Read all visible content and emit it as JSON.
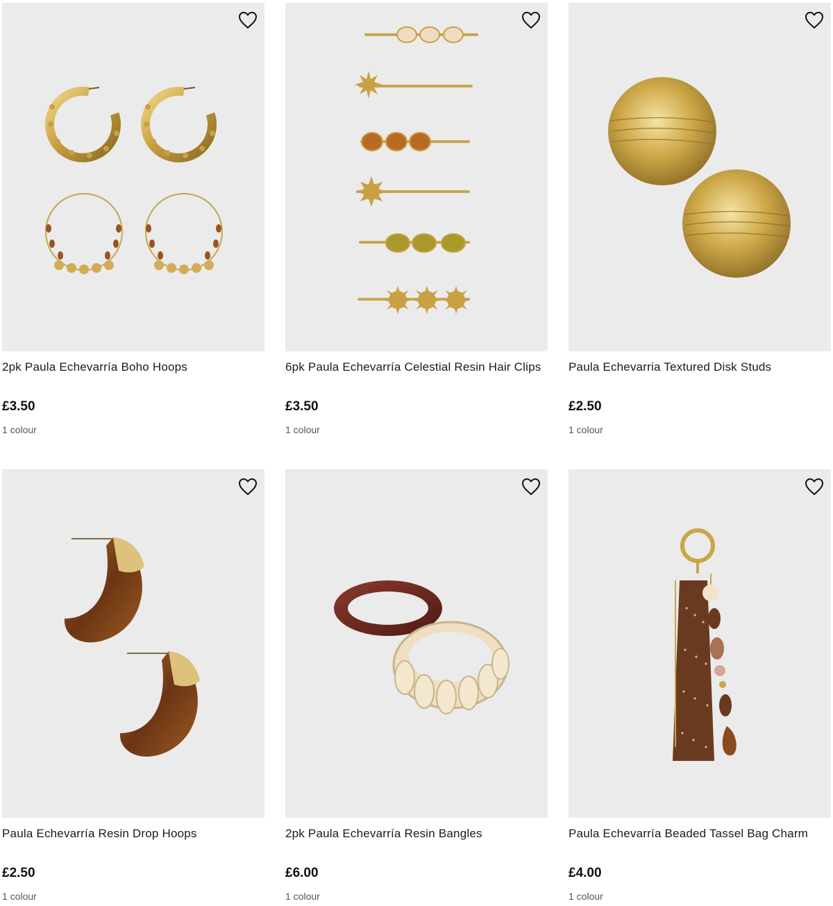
{
  "colors": {
    "thumb_background": "#ebebeb",
    "gold": "#c9a648",
    "text": "#1a1a1a",
    "muted": "#555555"
  },
  "products": [
    {
      "title": "2pk Paula Echevarría Boho Hoops",
      "price": "£3.50",
      "colours": "1 colour",
      "wishlist_icon": "heart-outline-icon"
    },
    {
      "title": "6pk Paula Echevarría Celestial Resin Hair Clips",
      "price": "£3.50",
      "colours": "1 colour",
      "wishlist_icon": "heart-outline-icon"
    },
    {
      "title": "Paula Echevarria Textured Disk Studs",
      "price": "£2.50",
      "colours": "1 colour",
      "wishlist_icon": "heart-outline-icon"
    },
    {
      "title": "Paula Echevarría Resin Drop Hoops",
      "price": "£2.50",
      "colours": "1 colour",
      "wishlist_icon": "heart-outline-icon"
    },
    {
      "title": "2pk Paula Echevarría Resin Bangles",
      "price": "£6.00",
      "colours": "1 colour",
      "wishlist_icon": "heart-outline-icon"
    },
    {
      "title": "Paula Echevarría Beaded Tassel Bag Charm",
      "price": "£4.00",
      "colours": "1 colour",
      "wishlist_icon": "heart-outline-icon"
    }
  ]
}
